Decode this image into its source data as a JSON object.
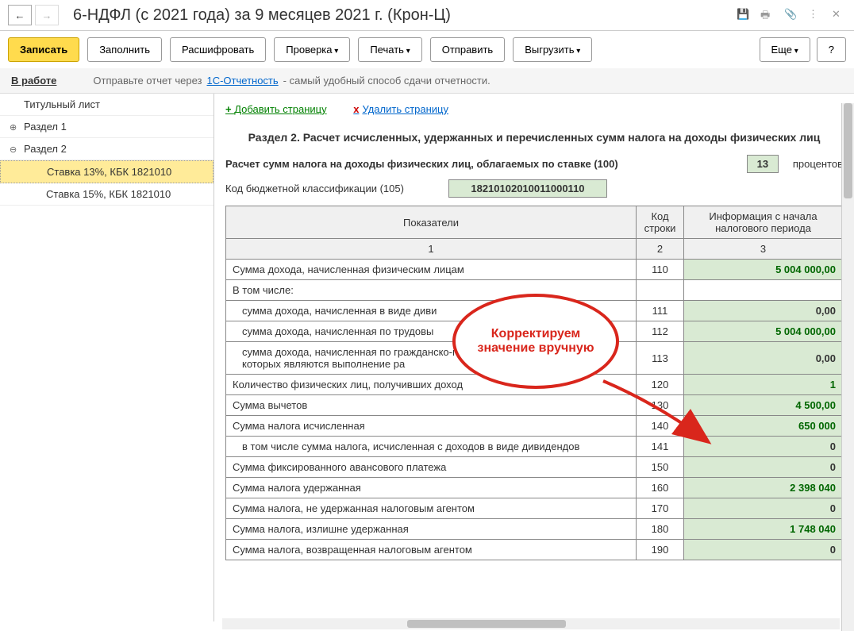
{
  "header": {
    "title": "6-НДФЛ (с 2021 года) за 9 месяцев 2021 г. (Крон-Ц)"
  },
  "toolbar": {
    "write": "Записать",
    "fill": "Заполнить",
    "decode": "Расшифровать",
    "check": "Проверка",
    "print": "Печать",
    "send": "Отправить",
    "upload": "Выгрузить",
    "more": "Еще",
    "help": "?"
  },
  "infobar": {
    "status": "В работе",
    "text1": "Отправьте отчет через",
    "link": "1С-Отчетность",
    "text2": "- самый удобный способ сдачи отчетности."
  },
  "tree": {
    "title_page": "Титульный лист",
    "section1": "Раздел 1",
    "section2": "Раздел 2",
    "rate13": "Ставка 13%, КБК 1821010",
    "rate15": "Ставка 15%, КБК 1821010"
  },
  "content": {
    "add_page": "Добавить страницу",
    "del_page": "Удалить страницу",
    "section_title": "Раздел 2. Расчет исчисленных, удержанных и перечисленных сумм налога на доходы физических лиц",
    "rate_label": "Расчет сумм налога на доходы физических лиц, облагаемых по ставке   (100)",
    "rate_value": "13",
    "rate_unit": "процентов",
    "kbk_label": "Код бюджетной классификации   (105)",
    "kbk_value": "18210102010011000110",
    "callout": "Корректируем значение вручную"
  },
  "grid": {
    "headers": {
      "c1": "Показатели",
      "c2": "Код строки",
      "c3": "Информация с начала налогового периода"
    },
    "sub": {
      "c1": "1",
      "c2": "2",
      "c3": "3"
    },
    "rows": [
      {
        "label": "Сумма дохода, начисленная физическим лицам",
        "code": "110",
        "value": "5 004 000,00",
        "hl": true
      },
      {
        "label": "В том числе:",
        "code": "",
        "value": "",
        "novalue": true
      },
      {
        "label": "сумма дохода, начисленная в виде диви",
        "code": "111",
        "value": "0,00",
        "indent": true
      },
      {
        "label": "сумма дохода, начисленная по трудовы",
        "code": "112",
        "value": "5 004 000,00",
        "hl": true,
        "indent": true
      },
      {
        "label": "сумма дохода, начисленная по гражданско-правовым договорам, предметом которых являются выполнение ра",
        "code": "113",
        "value": "0,00",
        "indent": true
      },
      {
        "label": "Количество физических лиц, получивших доход",
        "code": "120",
        "value": "1",
        "hl": true
      },
      {
        "label": "Сумма вычетов",
        "code": "130",
        "value": "4 500,00",
        "hl": true
      },
      {
        "label": "Сумма налога исчисленная",
        "code": "140",
        "value": "650 000",
        "hl": true
      },
      {
        "label": "в том числе сумма налога, исчисленная с доходов в виде дивидендов",
        "code": "141",
        "value": "0",
        "indent": true
      },
      {
        "label": "Сумма фиксированного авансового платежа",
        "code": "150",
        "value": "0"
      },
      {
        "label": "Сумма налога удержанная",
        "code": "160",
        "value": "2 398 040",
        "hl": true
      },
      {
        "label": "Сумма налога, не удержанная налоговым агентом",
        "code": "170",
        "value": "0"
      },
      {
        "label": "Сумма налога, излишне удержанная",
        "code": "180",
        "value": "1 748 040",
        "hl": true
      },
      {
        "label": "Сумма налога, возвращенная налоговым агентом",
        "code": "190",
        "value": "0"
      }
    ]
  }
}
